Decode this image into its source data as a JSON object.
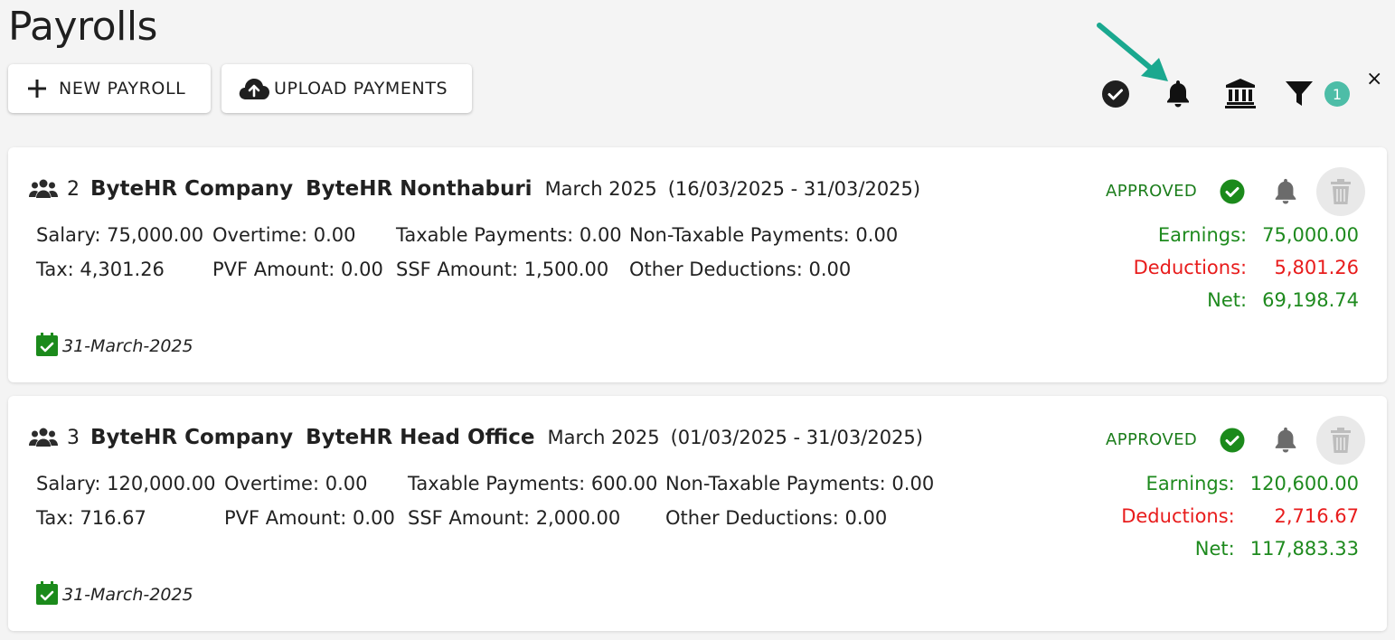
{
  "page": {
    "title": "Payrolls"
  },
  "actions": {
    "new_payroll": "NEW PAYROLL",
    "upload_payments": "UPLOAD PAYMENTS"
  },
  "toolbar": {
    "icons": [
      "check-circle-icon",
      "bell-icon",
      "bank-icon",
      "filter-icon"
    ],
    "filter_count": "1",
    "clear": "×"
  },
  "colors": {
    "approved": "#1b7d1b",
    "earnings": "#1e8a1e",
    "deductions": "#e81c1c",
    "badge": "#4dbda7",
    "arrow": "#1aa88f"
  },
  "payrolls": [
    {
      "count": "2",
      "company": "ByteHR Company",
      "branch": "ByteHR Nonthaburi",
      "month": "March 2025",
      "range": "(16/03/2025 - 31/03/2025)",
      "status": "APPROVED",
      "fields": {
        "salary": "Salary: 75,000.00",
        "overtime": "Overtime: 0.00",
        "taxable": "Taxable Payments: 0.00",
        "non_taxable": "Non-Taxable Payments: 0.00",
        "tax": "Tax: 4,301.26",
        "pvf": "PVF Amount: 0.00",
        "ssf": "SSF Amount: 1,500.00",
        "other": "Other Deductions: 0.00"
      },
      "earnings_label": "Earnings:",
      "earnings": "75,000.00",
      "deductions_label": "Deductions:",
      "deductions": "5,801.26",
      "net_label": "Net:",
      "net": "69,198.74",
      "date": "31-March-2025"
    },
    {
      "count": "3",
      "company": "ByteHR Company",
      "branch": "ByteHR Head Office",
      "month": "March 2025",
      "range": "(01/03/2025 - 31/03/2025)",
      "status": "APPROVED",
      "fields": {
        "salary": "Salary: 120,000.00",
        "overtime": "Overtime: 0.00",
        "taxable": "Taxable Payments: 600.00",
        "non_taxable": "Non-Taxable Payments: 0.00",
        "tax": "Tax: 716.67",
        "pvf": "PVF Amount: 0.00",
        "ssf": "SSF Amount: 2,000.00",
        "other": "Other Deductions: 0.00"
      },
      "earnings_label": "Earnings:",
      "earnings": "120,600.00",
      "deductions_label": "Deductions:",
      "deductions": "2,716.67",
      "net_label": "Net:",
      "net": "117,883.33",
      "date": "31-March-2025"
    }
  ]
}
